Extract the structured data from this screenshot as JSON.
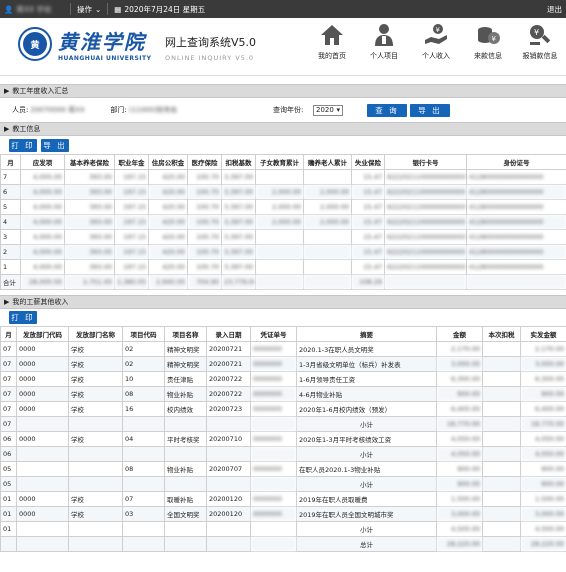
{
  "topbar": {
    "user": "蒋ХХ 学校",
    "ops": "操作",
    "date": "2020年7月24日 星期五",
    "exit": "退出"
  },
  "header": {
    "logo_cn": "黄淮学院",
    "logo_en": "HUANGHUAI UNIVERSITY",
    "seal": "黄",
    "sys_cn": "网上查询系统V5.0",
    "sys_en": "ONLINE INQUIRY V5.0",
    "nav": [
      {
        "label": "我的首页",
        "icon": "home-icon"
      },
      {
        "label": "个人项目",
        "icon": "person-icon"
      },
      {
        "label": "个人收入",
        "icon": "hand-money-icon"
      },
      {
        "label": "来款信息",
        "icon": "coins-icon"
      },
      {
        "label": "报销款信息",
        "icon": "reimburse-icon"
      }
    ]
  },
  "summary": {
    "title": "教工年度收入汇总",
    "person_label": "人员:",
    "person_value": "20070000 蒋ХХ",
    "dept_label": "部门:",
    "dept_value": "(11000)财务处",
    "year_label": "查询年份:",
    "year_value": "2020",
    "query_btn": "查 询",
    "export_btn": "导 出"
  },
  "staff": {
    "title": "教工信息",
    "print_btn": "打 印",
    "export_btn": "导 出",
    "headers": [
      "月",
      "应发项",
      "基本养老保险",
      "职业年金",
      "住房公积金",
      "医疗保险",
      "扣税基数",
      "子女教育累计",
      "赡养老人累计",
      "失业保险",
      "银行卡号",
      "身份证号"
    ],
    "rows": [
      [
        "7",
        "4,000.00",
        "393.00",
        "197.15",
        "420.00",
        "100.70",
        "3,397.00",
        "",
        "",
        "15.47",
        "6222021100000000000",
        "412800000000000000"
      ],
      [
        "6",
        "4,000.00",
        "393.00",
        "197.15",
        "420.00",
        "100.70",
        "3,397.00",
        "2,000.00",
        "2,000.00",
        "15.47",
        "6222021100000000000",
        "412800000000000000"
      ],
      [
        "5",
        "4,000.00",
        "393.00",
        "197.15",
        "420.00",
        "100.70",
        "3,397.00",
        "2,000.00",
        "2,000.00",
        "15.47",
        "6222021100000000000",
        "412800000000000000"
      ],
      [
        "4",
        "4,000.00",
        "393.00",
        "197.15",
        "420.00",
        "100.70",
        "3,397.00",
        "2,000.00",
        "2,000.00",
        "15.47",
        "6222021100000000000",
        "412800000000000000"
      ],
      [
        "3",
        "4,000.00",
        "393.00",
        "197.15",
        "420.00",
        "100.70",
        "3,397.00",
        "",
        "",
        "15.47",
        "6222021100000000000",
        "412800000000000000"
      ],
      [
        "2",
        "4,000.00",
        "393.00",
        "197.15",
        "420.00",
        "100.70",
        "3,397.00",
        "",
        "",
        "15.47",
        "6222021100000000000",
        "412800000000000000"
      ],
      [
        "1",
        "4,000.00",
        "393.00",
        "197.15",
        "420.00",
        "100.70",
        "3,397.00",
        "",
        "",
        "15.47",
        "6222021100000000000",
        "412800000000000000"
      ],
      [
        "合计",
        "28,000.00",
        "2,751.00",
        "1,380.05",
        "2,940.00",
        "704.90",
        "23,779.00",
        "",
        "",
        "108.29",
        "",
        ""
      ]
    ]
  },
  "other": {
    "title": "我的工薪其他收入",
    "print_btn": "打 印",
    "headers": [
      "月",
      "发放部门代码",
      "发放部门名称",
      "项目代码",
      "项目名称",
      "录入日期",
      "凭证单号",
      "摘要",
      "金额",
      "本次扣税",
      "实发金额"
    ],
    "rows": [
      [
        "07",
        "0000",
        "学校",
        "02",
        "精神文明奖",
        "20200721",
        "0000000",
        "2020.1-3在职人员文明奖",
        "2,170.00",
        "",
        "2,170.00"
      ],
      [
        "07",
        "0000",
        "学校",
        "02",
        "精神文明奖",
        "20200721",
        "0000000",
        "1-3月省级文明单位（标兵）补发表",
        "3,000.00",
        "",
        "3,000.00"
      ],
      [
        "07",
        "0000",
        "学校",
        "10",
        "责任津贴",
        "20200722",
        "0000000",
        "1-6月领导责任工资",
        "6,300.00",
        "",
        "6,300.00"
      ],
      [
        "07",
        "0000",
        "学校",
        "08",
        "物业补贴",
        "20200722",
        "0000000",
        "4-6月物业补贴",
        "900.00",
        "",
        "900.00"
      ],
      [
        "07",
        "0000",
        "学校",
        "16",
        "校内绩效",
        "20200723",
        "0000000",
        "2020年1-6月校内绩效（预发）",
        "6,400.00",
        "",
        "6,400.00"
      ],
      [
        "07",
        "",
        "",
        "",
        "",
        "",
        "",
        "小计",
        "18,770.00",
        "",
        "18,770.00"
      ],
      [
        "06",
        "0000",
        "学校",
        "04",
        "平时考核奖",
        "20200710",
        "0000000",
        "2020年1-3月平时考核绩效工资",
        "4,050.00",
        "",
        "4,050.00"
      ],
      [
        "06",
        "",
        "",
        "",
        "",
        "",
        "",
        "小计",
        "4,050.00",
        "",
        "4,050.00"
      ],
      [
        "05",
        "",
        "",
        "08",
        "物业补贴",
        "20200707",
        "0000000",
        "在职人员2020.1-3物业补贴",
        "900.00",
        "",
        "900.00"
      ],
      [
        "05",
        "",
        "",
        "",
        "",
        "",
        "",
        "小计",
        "900.00",
        "",
        "900.00"
      ],
      [
        "01",
        "0000",
        "学校",
        "07",
        "取暖补贴",
        "20200120",
        "0000000",
        "2019年在职人员取暖费",
        "1,500.00",
        "",
        "1,500.00"
      ],
      [
        "01",
        "0000",
        "学校",
        "03",
        "全国文明奖",
        "20200120",
        "0000000",
        "2019年在职人员全国文明城市奖",
        "3,000.00",
        "",
        "3,000.00"
      ],
      [
        "01",
        "",
        "",
        "",
        "",
        "",
        "",
        "小计",
        "4,500.00",
        "",
        "4,500.00"
      ],
      [
        "",
        "",
        "",
        "",
        "",
        "",
        "",
        "总计",
        "28,220.00",
        "",
        "28,220.00"
      ]
    ]
  }
}
